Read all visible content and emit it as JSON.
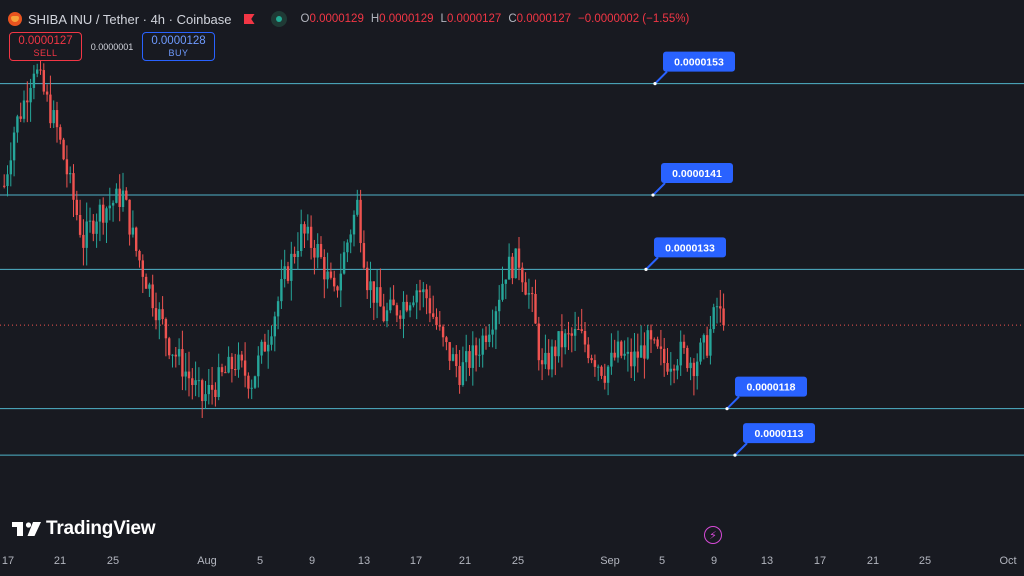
{
  "header": {
    "title": "SHIBA INU / Tether · 4h · Coinbase",
    "ohlc": {
      "o_key": "O",
      "o_val": "0.0000129",
      "h_key": "H",
      "h_val": "0.0000129",
      "l_key": "L",
      "l_val": "0.0000127",
      "c_key": "C",
      "c_val": "0.0000127",
      "change": "−0.0000002 (−1.55%)"
    }
  },
  "trade": {
    "sell_price": "0.0000127",
    "sell_label": "SELL",
    "spread": "0.0000001",
    "buy_price": "0.0000128",
    "buy_label": "BUY"
  },
  "brand": {
    "name": "TradingView"
  },
  "colors": {
    "background": "#181a21",
    "bull": "#26a69a",
    "bear": "#ef5350",
    "level_line": "#4fb3c9",
    "label_bg": "#2962ff",
    "sell": "#f23645",
    "buy": "#2962ff"
  },
  "chart_data": {
    "type": "candlestick",
    "timeframe": "4h",
    "ylim": [
      1.03e-05,
      1.62e-05
    ],
    "x_ticks": [
      "17",
      "21",
      "25",
      "Aug",
      "5",
      "9",
      "13",
      "17",
      "21",
      "25",
      "Sep",
      "5",
      "9",
      "13",
      "17",
      "21",
      "25",
      "Oct"
    ],
    "levels": [
      1.53e-05,
      1.41e-05,
      1.33e-05,
      1.18e-05,
      1.13e-05
    ],
    "level_labels": [
      "0.0000153",
      "0.0000141",
      "0.0000133",
      "0.0000118",
      "0.0000113"
    ],
    "current_price": 1.27e-05,
    "anchors": [
      [
        0,
        1.42e-05
      ],
      [
        3,
        1.48e-05
      ],
      [
        6,
        1.51e-05
      ],
      [
        9,
        1.55e-05
      ],
      [
        12,
        1.52e-05
      ],
      [
        16,
        1.48e-05
      ],
      [
        20,
        1.42e-05
      ],
      [
        24,
        1.36e-05
      ],
      [
        28,
        1.39e-05
      ],
      [
        32,
        1.4e-05
      ],
      [
        36,
        1.41e-05
      ],
      [
        40,
        1.35e-05
      ],
      [
        45,
        1.3e-05
      ],
      [
        50,
        1.25e-05
      ],
      [
        55,
        1.22e-05
      ],
      [
        60,
        1.19e-05
      ],
      [
        65,
        1.21e-05
      ],
      [
        70,
        1.23e-05
      ],
      [
        75,
        1.21e-05
      ],
      [
        80,
        1.26e-05
      ],
      [
        85,
        1.32e-05
      ],
      [
        90,
        1.37e-05
      ],
      [
        95,
        1.35e-05
      ],
      [
        100,
        1.3e-05
      ],
      [
        104,
        1.36e-05
      ],
      [
        107,
        1.4e-05
      ],
      [
        110,
        1.32e-05
      ],
      [
        115,
        1.28e-05
      ],
      [
        120,
        1.29e-05
      ],
      [
        125,
        1.31e-05
      ],
      [
        128,
        1.3e-05
      ],
      [
        133,
        1.25e-05
      ],
      [
        138,
        1.22e-05
      ],
      [
        143,
        1.24e-05
      ],
      [
        148,
        1.28e-05
      ],
      [
        152,
        1.33e-05
      ],
      [
        156,
        1.34e-05
      ],
      [
        160,
        1.29e-05
      ],
      [
        163,
        1.22e-05
      ],
      [
        168,
        1.25e-05
      ],
      [
        174,
        1.26e-05
      ],
      [
        178,
        1.24e-05
      ],
      [
        182,
        1.22e-05
      ],
      [
        186,
        1.24e-05
      ],
      [
        190,
        1.23e-05
      ],
      [
        195,
        1.25e-05
      ],
      [
        200,
        1.23e-05
      ],
      [
        205,
        1.24e-05
      ],
      [
        209,
        1.23e-05
      ],
      [
        213,
        1.25e-05
      ],
      [
        216,
        1.29e-05
      ],
      [
        218,
        1.27e-05
      ]
    ],
    "wicks": {
      "min": 1.17e-05,
      "max": 1.58e-05
    }
  }
}
